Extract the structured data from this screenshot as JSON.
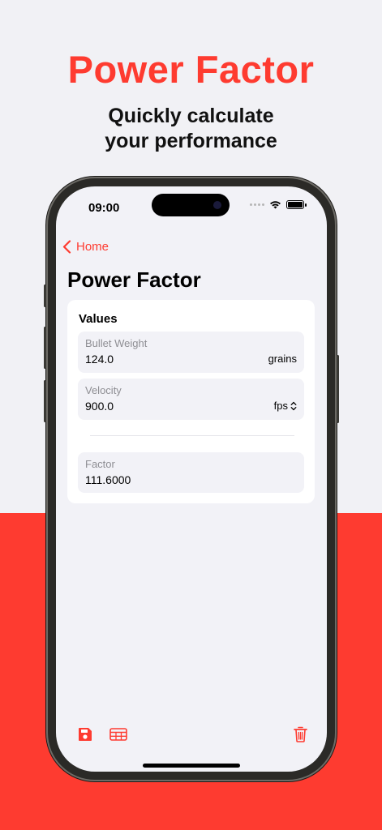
{
  "promo": {
    "title": "Power Factor",
    "subtitle_line1": "Quickly calculate",
    "subtitle_line2": "your performance"
  },
  "colors": {
    "accent": "#fe3b30",
    "background": "#f1f1f5",
    "card": "#ffffff",
    "field": "#f2f2f7"
  },
  "status_bar": {
    "time": "09:00",
    "icons": [
      "signal-dots-icon",
      "wifi-icon",
      "battery-icon"
    ]
  },
  "nav": {
    "back_label": "Home",
    "title": "Power Factor"
  },
  "values_card": {
    "heading": "Values",
    "fields": [
      {
        "label": "Bullet Weight",
        "value": "124.0",
        "unit": "grains"
      },
      {
        "label": "Velocity",
        "value": "900.0",
        "unit": "fps"
      }
    ],
    "result": {
      "label": "Factor",
      "value": "111.6000"
    }
  },
  "toolbar": {
    "left_icons": [
      "save-icon",
      "table-icon"
    ],
    "right_icons": [
      "trash-icon"
    ]
  }
}
